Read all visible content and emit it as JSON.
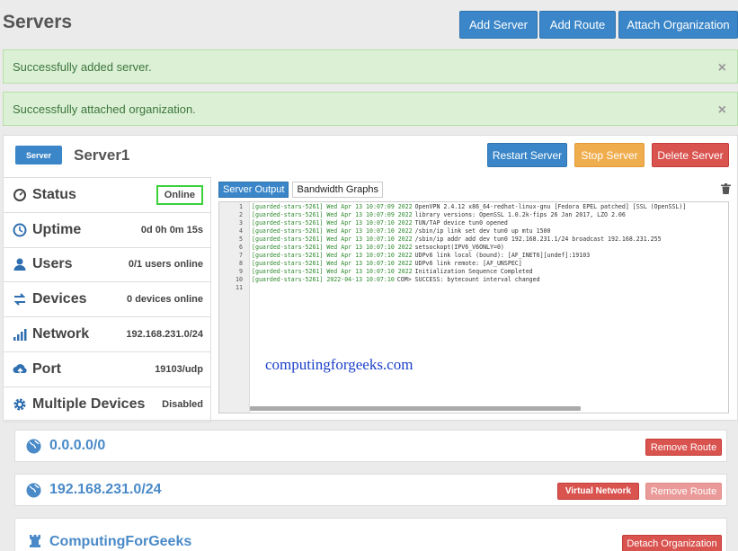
{
  "header": {
    "title": "Servers",
    "add_server": "Add Server",
    "add_route": "Add Route",
    "attach_organization": "Attach Organization"
  },
  "alerts": [
    {
      "text": "Successfully added server.",
      "close": "×"
    },
    {
      "text": "Successfully attached organization.",
      "close": "×"
    }
  ],
  "server": {
    "badge": "Server",
    "name": "Server1",
    "restart": "Restart Server",
    "stop": "Stop Server",
    "delete": "Delete Server",
    "stats": [
      {
        "icon": "speedometer-icon",
        "label": "Status",
        "value": "Online"
      },
      {
        "icon": "clock-icon",
        "label": "Uptime",
        "value": "0d 0h 0m 15s"
      },
      {
        "icon": "user-icon",
        "label": "Users",
        "value": "0/1 users online"
      },
      {
        "icon": "devices-icon",
        "label": "Devices",
        "value": "0 devices online"
      },
      {
        "icon": "signal-icon",
        "label": "Network",
        "value": "192.168.231.0/24"
      },
      {
        "icon": "upload-cloud-icon",
        "label": "Port",
        "value": "19103/udp"
      },
      {
        "icon": "gear-icon",
        "label": "Multiple Devices",
        "value": "Disabled"
      }
    ],
    "tabs": {
      "output": "Server Output",
      "graphs": "Bandwidth Graphs"
    },
    "log": [
      {
        "n": "1",
        "ts": "[guarded-stars-5261] Wed Apr 13 10:07:09 2022",
        "msg": "OpenVPN 2.4.12 x86_64-redhat-linux-gnu [Fedora EPEL patched] [SSL (OpenSSL)]"
      },
      {
        "n": "2",
        "ts": "[guarded-stars-5261] Wed Apr 13 10:07:09 2022",
        "msg": "library versions: OpenSSL 1.0.2k-fips  26 Jan 2017, LZO 2.06"
      },
      {
        "n": "3",
        "ts": "[guarded-stars-5261] Wed Apr 13 10:07:10 2022",
        "msg": "TUN/TAP device tun0 opened"
      },
      {
        "n": "4",
        "ts": "[guarded-stars-5261] Wed Apr 13 10:07:10 2022",
        "msg": "/sbin/ip link set dev tun0 up mtu 1500"
      },
      {
        "n": "5",
        "ts": "[guarded-stars-5261] Wed Apr 13 10:07:10 2022",
        "msg": "/sbin/ip addr add dev tun0 192.168.231.1/24 broadcast 192.168.231.255"
      },
      {
        "n": "6",
        "ts": "[guarded-stars-5261] Wed Apr 13 10:07:10 2022",
        "msg": "setsockopt(IPV6_V6ONLY=0)"
      },
      {
        "n": "7",
        "ts": "[guarded-stars-5261] Wed Apr 13 10:07:10 2022",
        "msg": "UDPv6 link local (bound): [AF_INET6][undef]:19103"
      },
      {
        "n": "8",
        "ts": "[guarded-stars-5261] Wed Apr 13 10:07:10 2022",
        "msg": "UDPv6 link remote: [AF_UNSPEC]"
      },
      {
        "n": "9",
        "ts": "[guarded-stars-5261] Wed Apr 13 10:07:10 2022",
        "msg": "Initialization Sequence Completed"
      },
      {
        "n": "10",
        "ts": "[guarded-stars-5261] 2022-04-13 10:07:10",
        "msg": "COM> SUCCESS: bytecount interval changed"
      },
      {
        "n": "11",
        "ts": "",
        "msg": ""
      }
    ],
    "watermark": "computingforgeeks.com"
  },
  "routes": [
    {
      "label": "0.0.0.0/0",
      "remove": "Remove Route"
    },
    {
      "label": "192.168.231.0/24",
      "virtual": "Virtual Network",
      "remove": "Remove Route"
    }
  ],
  "organization": {
    "label": "ComputingForGeeks",
    "detach": "Detach Organization"
  }
}
